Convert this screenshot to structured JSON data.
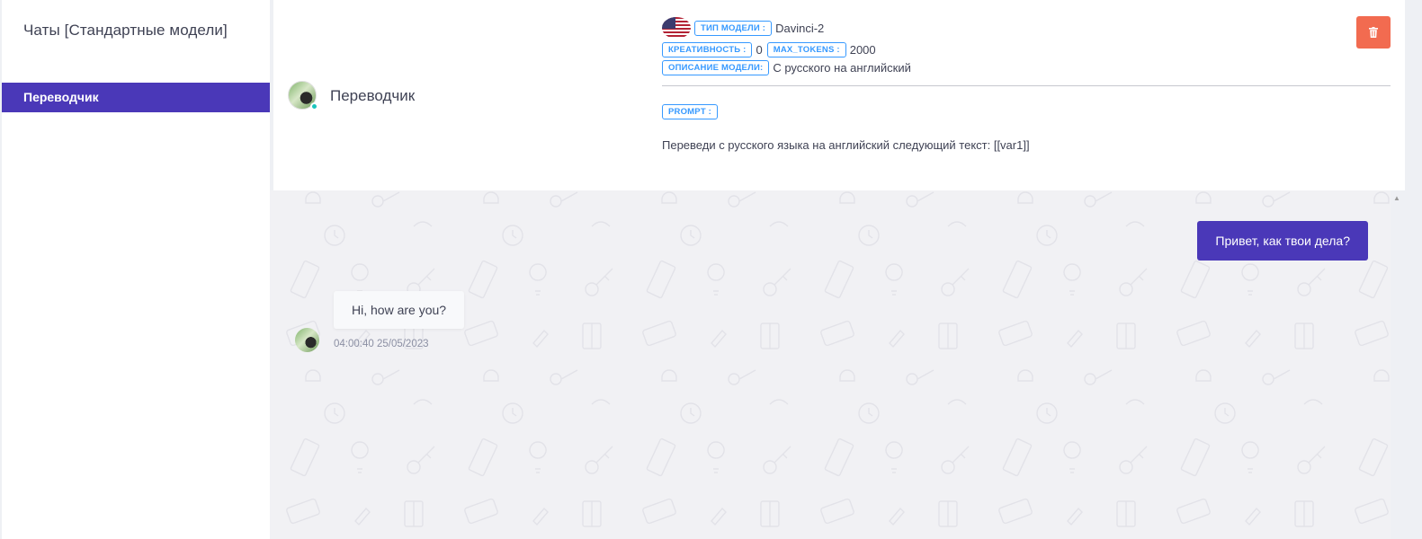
{
  "sidebar": {
    "title": "Чаты [Стандартные модели]",
    "items": [
      {
        "label": "Переводчик",
        "active": true
      }
    ]
  },
  "header": {
    "chat_title": "Переводчик",
    "model_type_label": "ТИП МОДЕЛИ :",
    "model_type_value": "Davinci-2",
    "creativity_label": "КРЕАТИВНОСТЬ :",
    "creativity_value": "0",
    "max_tokens_label": "MAX_TOKENS :",
    "max_tokens_value": "2000",
    "description_label": "ОПИСАНИЕ МОДЕЛИ:",
    "description_value": "С русского на английский",
    "prompt_label": "PROMPT :",
    "prompt_text": "Переведи с русского языка на английский следующий текст: [[var1]]"
  },
  "messages": [
    {
      "direction": "outgoing",
      "text": "Привет, как твои дела?"
    },
    {
      "direction": "incoming",
      "text": "Hi, how are you?",
      "timestamp": "04:00:40 25/05/2023"
    }
  ],
  "colors": {
    "accent": "#4a38b8",
    "delete": "#f26b50",
    "tag": "#3699ff",
    "online": "#1bc5bd"
  },
  "icons": {
    "delete": "trash-icon",
    "flag": "us-flag-icon"
  }
}
